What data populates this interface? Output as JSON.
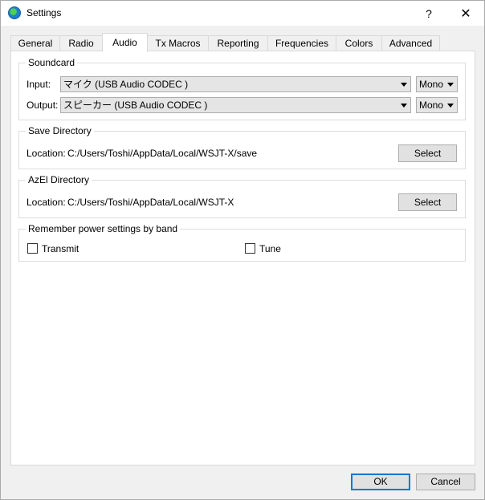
{
  "window": {
    "title": "Settings",
    "help_glyph": "?",
    "close_glyph": "✕"
  },
  "tabs": [
    {
      "label": "General"
    },
    {
      "label": "Radio"
    },
    {
      "label": "Audio"
    },
    {
      "label": "Tx Macros"
    },
    {
      "label": "Reporting"
    },
    {
      "label": "Frequencies"
    },
    {
      "label": "Colors"
    },
    {
      "label": "Advanced"
    }
  ],
  "active_tab": "Audio",
  "soundcard": {
    "title": "Soundcard",
    "input_label": "Input:",
    "input_device": "マイク (USB Audio CODEC )",
    "input_channel": "Mono",
    "output_label": "Output:",
    "output_device": "スピーカー (USB Audio CODEC )",
    "output_channel": "Mono"
  },
  "save_directory": {
    "title": "Save Directory",
    "location_label": "Location:",
    "path": "C:/Users/Toshi/AppData/Local/WSJT-X/save",
    "select_label": "Select"
  },
  "azel_directory": {
    "title": "AzEl Directory",
    "location_label": "Location:",
    "path": "C:/Users/Toshi/AppData/Local/WSJT-X",
    "select_label": "Select"
  },
  "power_settings": {
    "title": "Remember power settings by band",
    "transmit_label": "Transmit",
    "transmit_checked": false,
    "tune_label": "Tune",
    "tune_checked": false
  },
  "footer": {
    "ok_label": "OK",
    "cancel_label": "Cancel"
  },
  "colors": {
    "accent": "#0078d7",
    "panel_bg": "#ffffff",
    "window_bg": "#f0f0f0"
  }
}
